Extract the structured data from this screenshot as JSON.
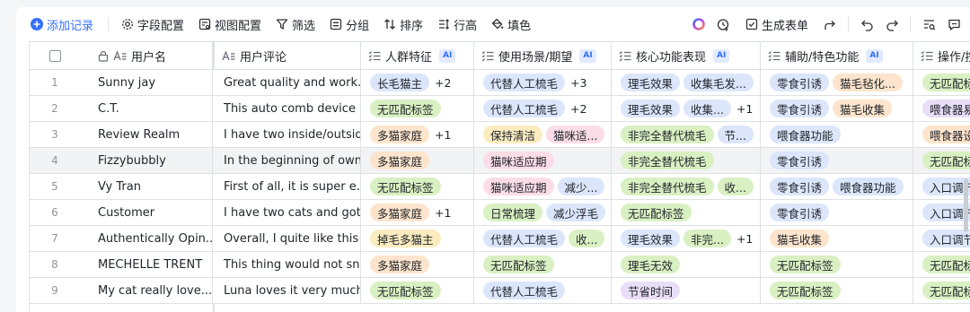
{
  "toolbar": {
    "add_record": "添加记录",
    "field_config": "字段配置",
    "view_config": "视图配置",
    "filter": "筛选",
    "group": "分组",
    "sort": "排序",
    "row_height": "行高",
    "fill_color": "填色",
    "generate_form": "生成表单"
  },
  "columns": {
    "username": "用户名",
    "review": "用户评论",
    "crowd": "人群特征",
    "scene": "使用场景/期望",
    "core": "核心功能表现",
    "aux": "辅助/特色功能",
    "ops": "操作/控制",
    "ai_badge": "AI"
  },
  "colors": {
    "accent": "#3370ff",
    "tag_blue": "#dbe6fb",
    "tag_green": "#d9f0c2",
    "tag_orange": "#fde4cc",
    "tag_pink": "#fcdde7",
    "tag_yellow": "#fbecc0",
    "tag_purple": "#e8def8",
    "tag_gray": "#eceef1"
  },
  "rows": [
    {
      "num": "1",
      "name": "Sunny jay",
      "review": "Great quality and work...",
      "crowd": [
        "长毛猫主"
      ],
      "crowd_more": "+2",
      "scene": [
        "代替人工梳毛"
      ],
      "scene_more": "+3",
      "core": [
        "理毛效果",
        "收集毛发..."
      ],
      "core_more": "",
      "aux": [
        "零食引诱",
        "猫毛毡化..."
      ],
      "ops": [
        "无匹配标签"
      ]
    },
    {
      "num": "2",
      "name": "C.T.",
      "review": "This auto comb device ...",
      "crowd": [
        "无匹配标签"
      ],
      "crowd_more": "",
      "scene": [
        "代替人工梳毛"
      ],
      "scene_more": "+2",
      "core": [
        "理毛效果",
        "收集..."
      ],
      "core_more": "+1",
      "aux": [
        "零食引诱",
        "猫毛收集"
      ],
      "ops": [
        "喂食器易控"
      ]
    },
    {
      "num": "3",
      "name": "Review Realm",
      "review": "I have two inside/outsid...",
      "crowd": [
        "多猫家庭"
      ],
      "crowd_more": "+1",
      "scene": [
        "保持清洁",
        "猫咪适..."
      ],
      "scene_more": "",
      "core": [
        "非完全替代梳毛",
        "节..."
      ],
      "core_more": "",
      "aux": [
        "喂食器功能"
      ],
      "ops": [
        "喂食器设置"
      ]
    },
    {
      "num": "4",
      "name": "Fizzybubbly",
      "review": "In the beginning of own...",
      "crowd": [
        "多猫家庭"
      ],
      "crowd_more": "",
      "scene": [
        "猫咪适应期"
      ],
      "scene_more": "",
      "core": [
        "非完全替代梳毛"
      ],
      "core_more": "",
      "aux": [
        "零食引诱"
      ],
      "ops": [
        "无匹配标签"
      ]
    },
    {
      "num": "5",
      "name": "Vy Tran",
      "review": "First of all, it is super e...",
      "crowd": [
        "无匹配标签"
      ],
      "crowd_more": "",
      "scene": [
        "猫咪适应期",
        "减少..."
      ],
      "scene_more": "",
      "core": [
        "非完全替代梳毛",
        "收..."
      ],
      "core_more": "",
      "aux": [
        "零食引诱",
        "喂食器功能"
      ],
      "ops": [
        "入口调节"
      ]
    },
    {
      "num": "6",
      "name": "Customer",
      "review": "I have two cats and got...",
      "crowd": [
        "多猫家庭"
      ],
      "crowd_more": "+1",
      "scene": [
        "日常梳理",
        "减少浮毛"
      ],
      "scene_more": "",
      "core": [
        "无匹配标签"
      ],
      "core_more": "",
      "aux": [
        "零食引诱"
      ],
      "ops": [
        "入口调节"
      ]
    },
    {
      "num": "7",
      "name": "Authentically Opin...",
      "review": "Overall, I quite like this ...",
      "crowd": [
        "掉毛多猫主"
      ],
      "crowd_more": "",
      "scene": [
        "代替人工梳毛",
        "收..."
      ],
      "scene_more": "",
      "core": [
        "理毛效果",
        "非完..."
      ],
      "core_more": "+1",
      "aux": [
        "猫毛收集"
      ],
      "ops": [
        "入口调节"
      ]
    },
    {
      "num": "8",
      "name": "MECHELLE TRENT",
      "review": "This thing would not sn...",
      "crowd": [
        "多猫家庭"
      ],
      "crowd_more": "",
      "scene": [
        "无匹配标签"
      ],
      "scene_more": "",
      "core": [
        "理毛无效"
      ],
      "core_more": "",
      "aux": [
        "无匹配标签"
      ],
      "ops": [
        "无匹配标签"
      ]
    },
    {
      "num": "9",
      "name": "My cat really love...",
      "review": "Luna loves it very much...",
      "crowd": [
        "无匹配标签"
      ],
      "crowd_more": "",
      "scene": [
        "代替人工梳毛"
      ],
      "scene_more": "",
      "core": [
        "节省时间"
      ],
      "core_more": "",
      "aux": [
        "无匹配标签"
      ],
      "ops": [
        "无匹配标签"
      ]
    }
  ]
}
